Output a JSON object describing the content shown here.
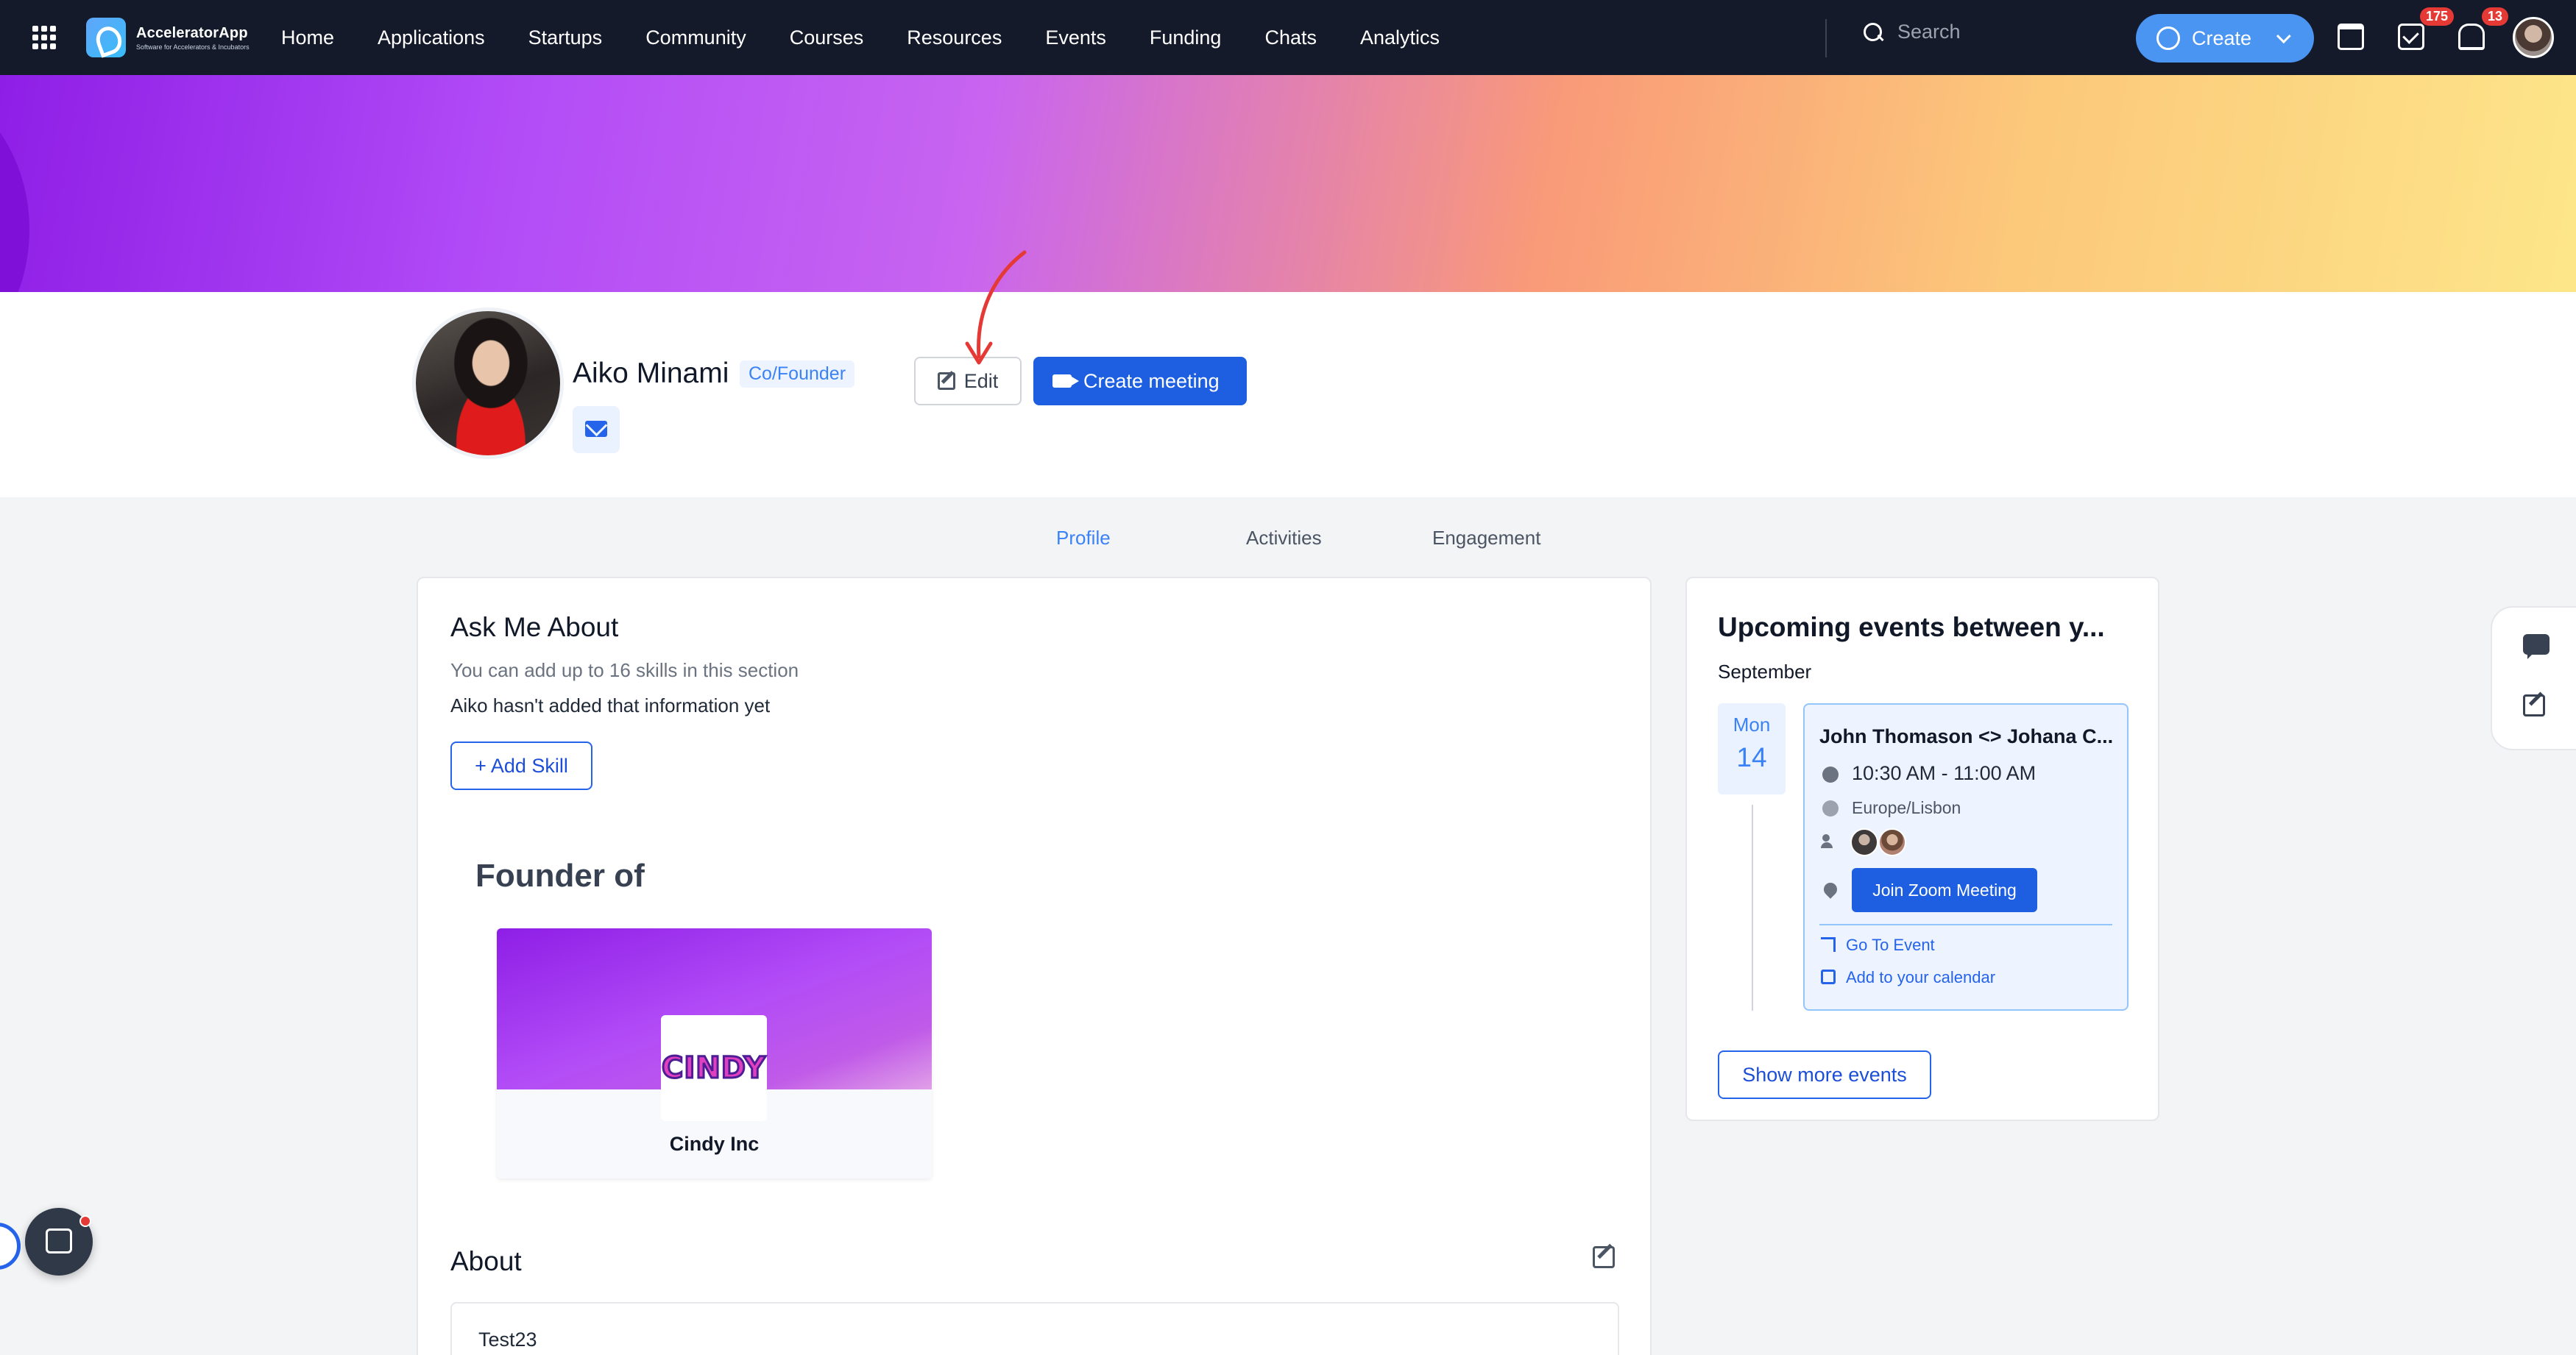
{
  "app": {
    "logo_title": "AcceleratorApp",
    "logo_subtitle": "Software for Accelerators & Incubators"
  },
  "nav": {
    "links": [
      "Home",
      "Applications",
      "Startups",
      "Community",
      "Courses",
      "Resources",
      "Events",
      "Funding",
      "Chats",
      "Analytics"
    ],
    "search_placeholder": "Search",
    "create_label": "Create",
    "tasks_count": "175",
    "notifications_count": "13"
  },
  "profile": {
    "name": "Aiko Minami",
    "role": "Co/Founder",
    "edit_label": "Edit",
    "create_meeting_label": "Create meeting"
  },
  "tabs": [
    "Profile",
    "Activities",
    "Engagement"
  ],
  "active_tab": "Profile",
  "ask_me_about": {
    "heading": "Ask Me About",
    "hint": "You can add up to 16 skills in this section",
    "empty": "Aiko hasn't added that information yet",
    "add_skill_label": "+ Add Skill"
  },
  "founder_of": {
    "heading": "Founder of",
    "startup_logo_text": "CINDY",
    "startup_name": "Cindy Inc"
  },
  "about": {
    "heading": "About",
    "text": "Test23"
  },
  "events": {
    "heading": "Upcoming events between y...",
    "month": "September",
    "day_of_week": "Mon",
    "day": "14",
    "event_title": "John Thomason <> Johana C...",
    "time": "10:30 AM - 11:00 AM",
    "timezone": "Europe/Lisbon",
    "join_label": "Join Zoom Meeting",
    "go_to_event": "Go To Event",
    "add_to_calendar": "Add to your calendar",
    "show_more_label": "Show more events"
  },
  "colors": {
    "nav_bg": "#141a2a",
    "accent": "#1d5fe0",
    "create_button": "#4a95f2",
    "badge": "#e53935"
  }
}
